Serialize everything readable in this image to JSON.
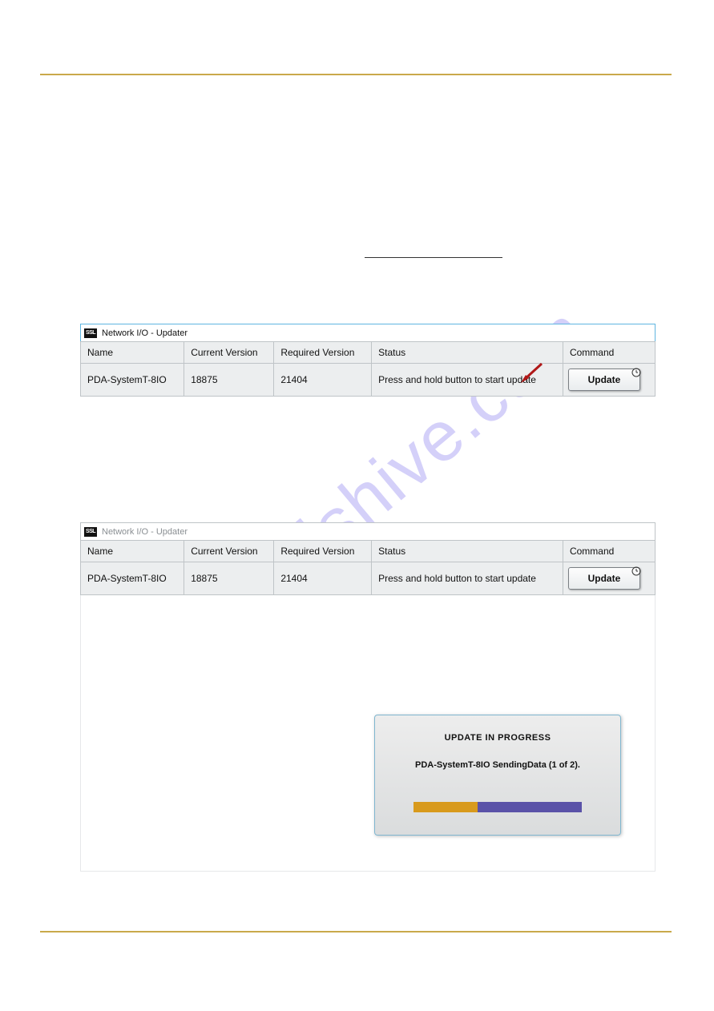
{
  "watermark": "manualshive.com",
  "updater": {
    "window_title": "Network I/O - Updater",
    "columns": [
      "Name",
      "Current Version",
      "Required Version",
      "Status",
      "Command"
    ],
    "row": {
      "name": "PDA-SystemT-8IO",
      "current_version": "18875",
      "required_version": "21404",
      "status": "Press and hold button to start update",
      "command_label": "Update"
    }
  },
  "progress": {
    "title": "UPDATE IN PROGRESS",
    "message": "PDA-SystemT-8IO SendingData (1 of 2).",
    "percent": 38
  }
}
